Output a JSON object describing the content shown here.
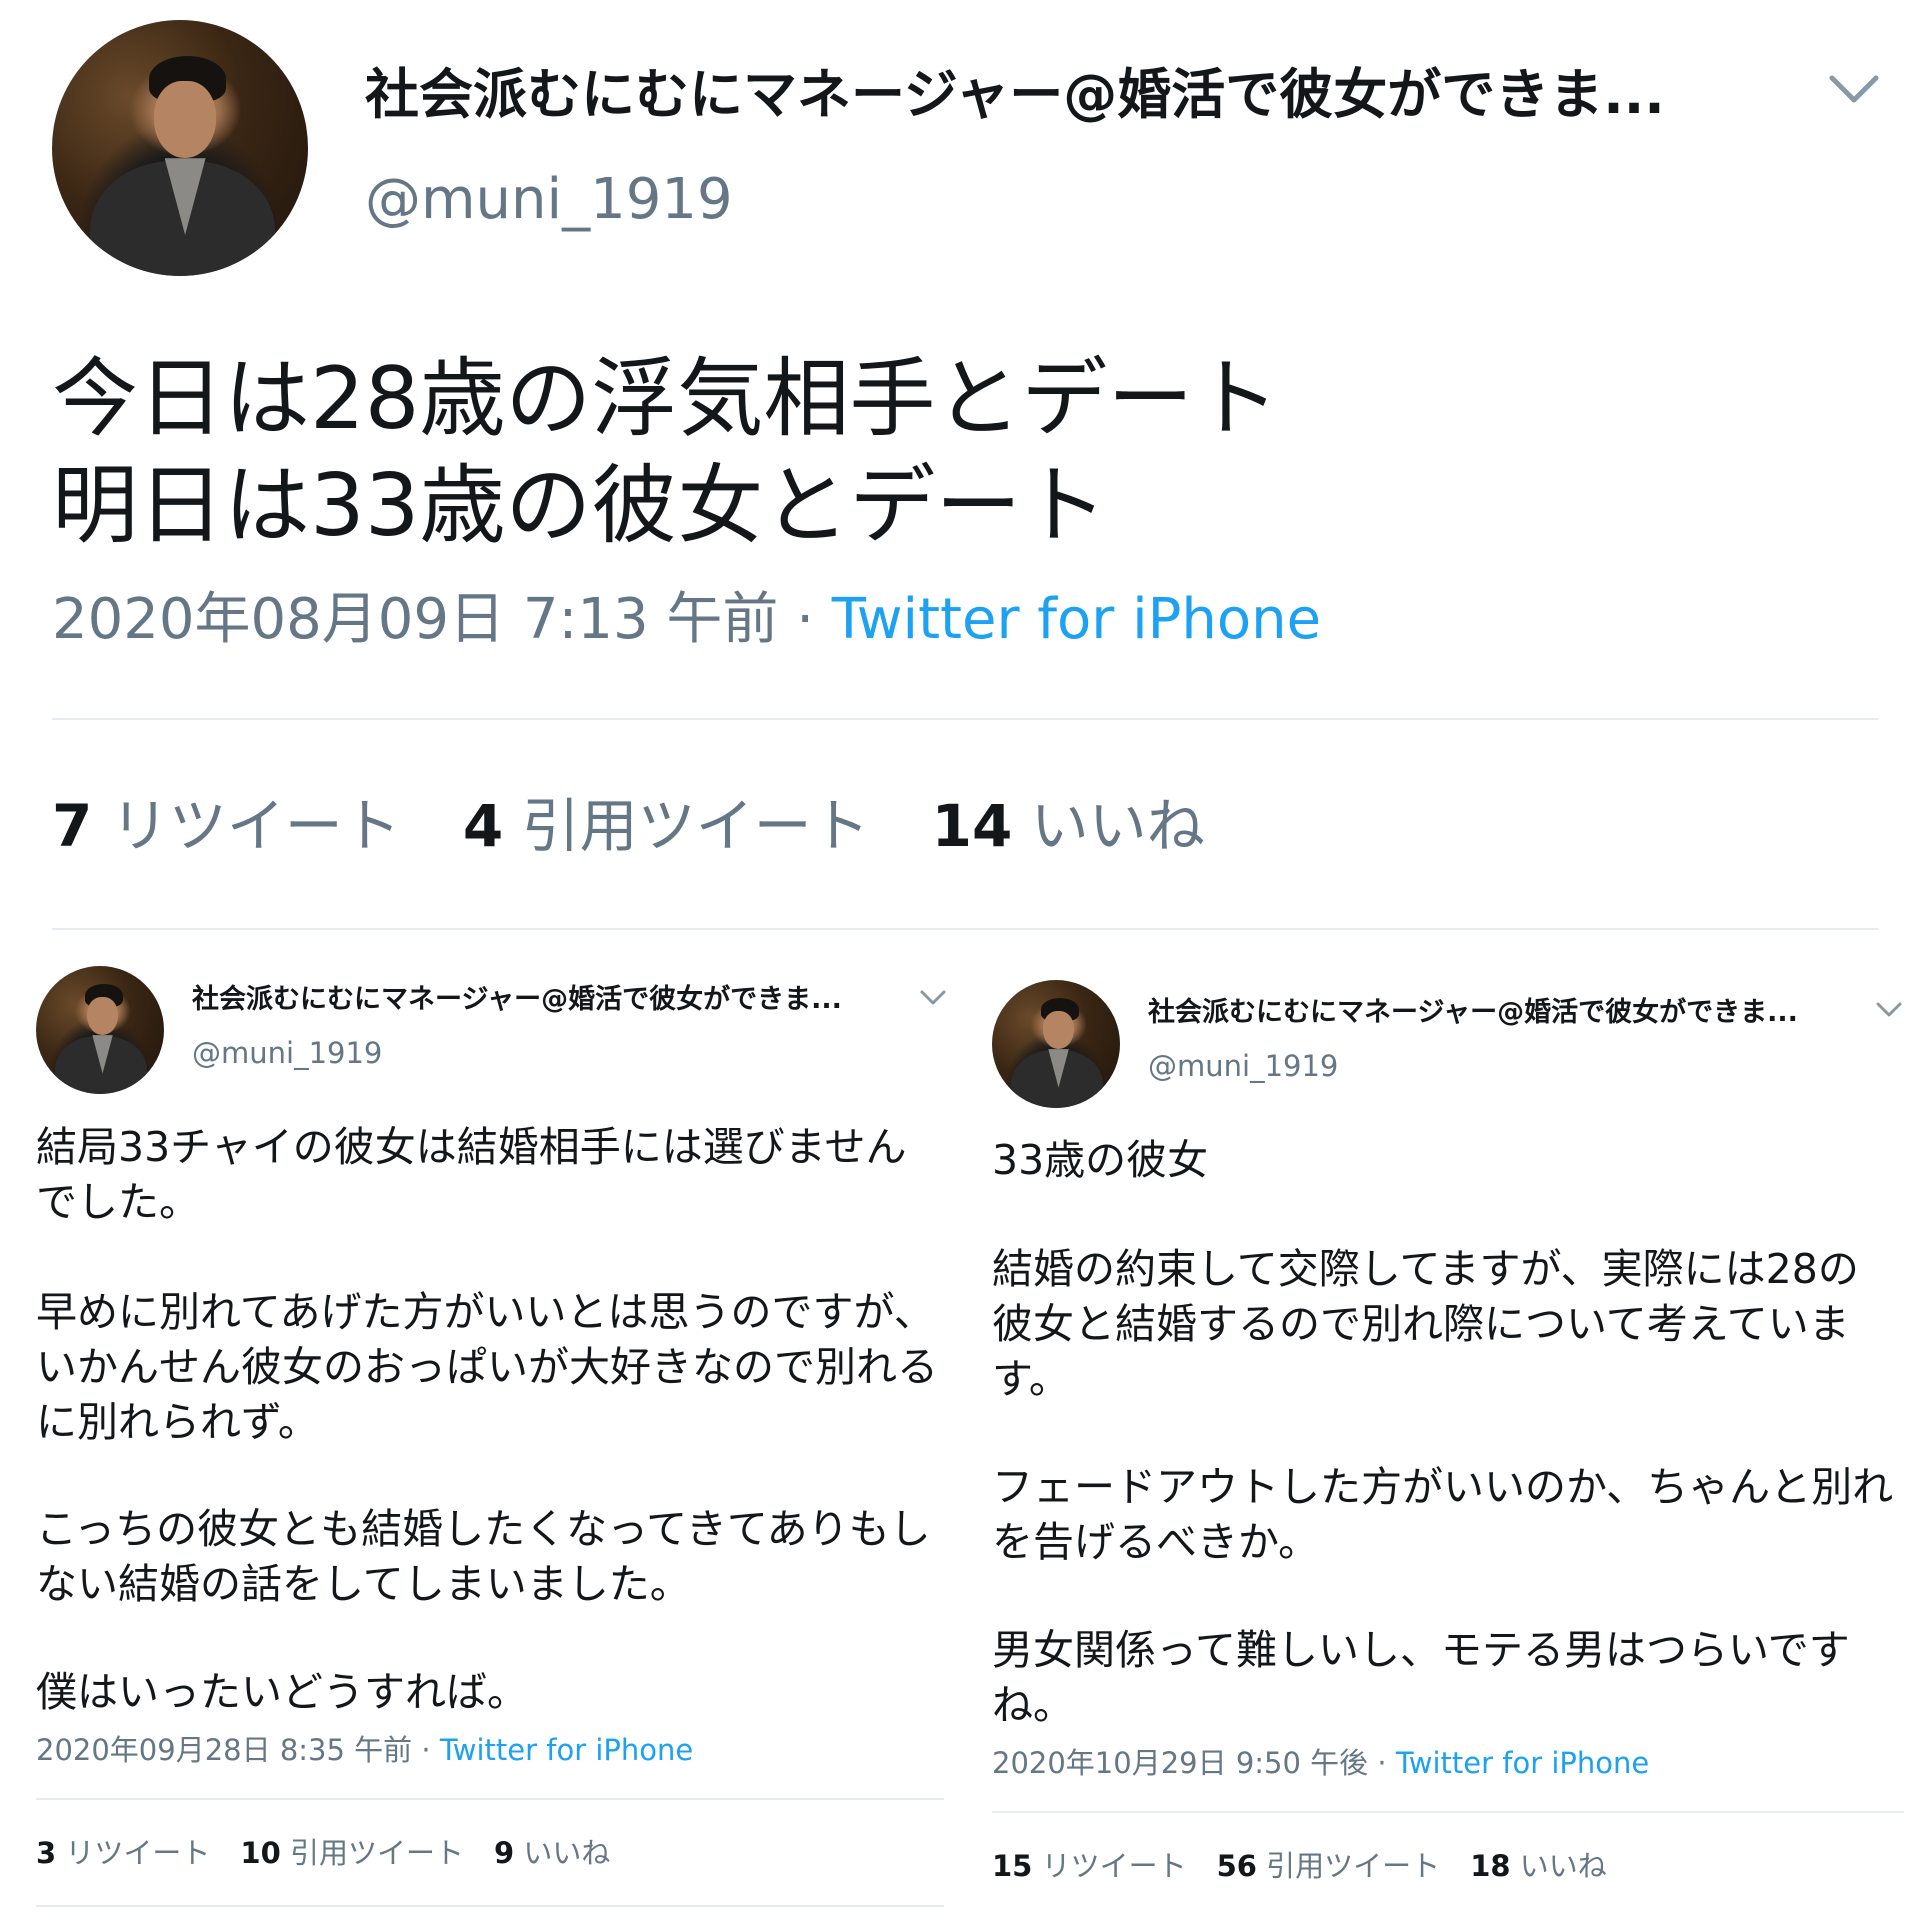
{
  "main": {
    "display_name": "社会派むにむにマネージャー@婚活で彼女ができま...",
    "handle": "@muni_1919",
    "text_line1": "今日は28歳の浮気相手とデート",
    "text_line2": "明日は33歳の彼女とデート",
    "timestamp": "2020年08月09日 7:13 午前",
    "separator": " · ",
    "source": "Twitter for iPhone",
    "retweets_count": "7",
    "retweets_label": "リツイート",
    "quotes_count": "4",
    "quotes_label": "引用ツイート",
    "likes_count": "14",
    "likes_label": "いいね"
  },
  "left": {
    "display_name": "社会派むにむにマネージャー@婚活で彼女ができま...",
    "handle": "@muni_1919",
    "para1": "結局33チャイの彼女は結婚相手には選びません\nでした。",
    "para2": "早めに別れてあげた方がいいとは思うのですが、\nいかんせん彼女のおっぱいが大好きなので別れる\nに別れられず。",
    "para3": "こっちの彼女とも結婚したくなってきてありもし\nない結婚の話をしてしまいました。",
    "para4": "僕はいったいどうすれば。",
    "timestamp": "2020年09月28日 8:35 午前",
    "separator": " · ",
    "source": "Twitter for iPhone",
    "retweets_count": "3",
    "retweets_label": "リツイート",
    "quotes_count": "10",
    "quotes_label": "引用ツイート",
    "likes_count": "9",
    "likes_label": "いいね"
  },
  "right": {
    "display_name": "社会派むにむにマネージャー@婚活で彼女ができま...",
    "handle": "@muni_1919",
    "para1": "33歳の彼女",
    "para2": "結婚の約束して交際してますが、実際には28の\n彼女と結婚するので別れ際について考えていま\nす。",
    "para3": "フェードアウトした方がいいのか、ちゃんと別れ\nを告げるべきか。",
    "para4": "男女関係って難しいし、モテる男はつらいです\nね。",
    "timestamp": "2020年10月29日 9:50 午後",
    "separator": " · ",
    "source": "Twitter for iPhone",
    "retweets_count": "15",
    "retweets_label": "リツイート",
    "quotes_count": "56",
    "quotes_label": "引用ツイート",
    "likes_count": "18",
    "likes_label": "いいね"
  },
  "colors": {
    "text": "#14171a",
    "secondary": "#657786",
    "link": "#1da1f2",
    "divider": "#e6ecf0"
  },
  "icons": [
    "avatar",
    "chevron-down-icon"
  ]
}
